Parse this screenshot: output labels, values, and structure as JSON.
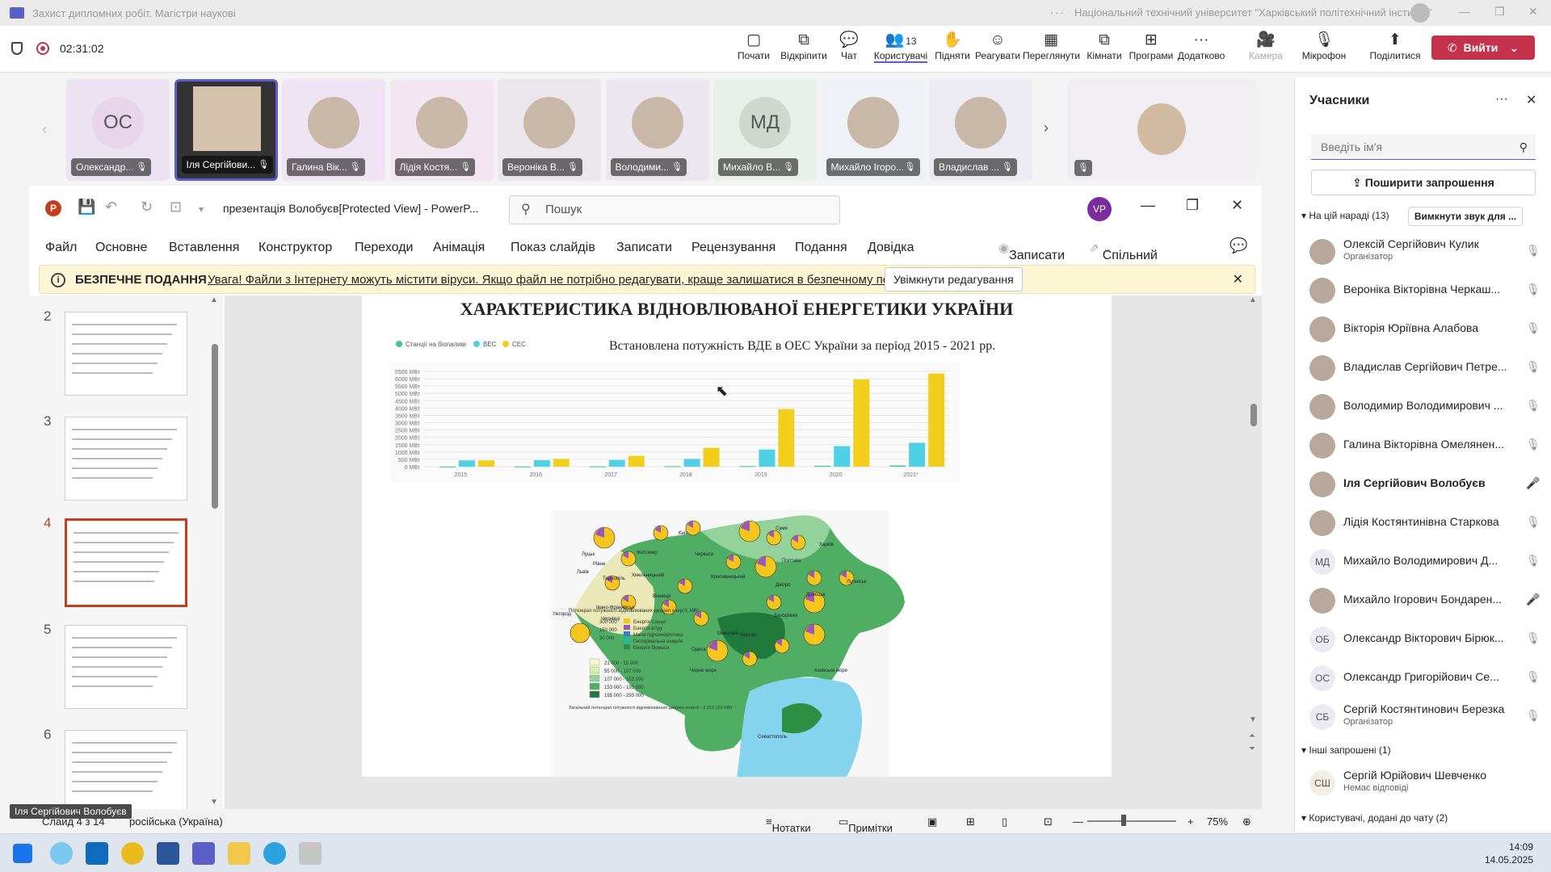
{
  "window": {
    "title": "Захист дипломних робіт. Магістри наукові",
    "org": "Національний технічний університет \"Харківський політехнічний інститут\"",
    "dots": "···"
  },
  "meeting": {
    "timer": "02:31:02",
    "toolbar": [
      {
        "id": "start",
        "label": "Почати",
        "icon": "▢"
      },
      {
        "id": "unpin",
        "label": "Відкріпити",
        "icon": "⧉"
      },
      {
        "id": "chat",
        "label": "Чат",
        "icon": "💬"
      },
      {
        "id": "people",
        "label": "Користувачі",
        "icon": "👥",
        "count": "13",
        "active": true
      },
      {
        "id": "raise",
        "label": "Підняти",
        "icon": "✋"
      },
      {
        "id": "react",
        "label": "Реагувати",
        "icon": "☺"
      },
      {
        "id": "view",
        "label": "Переглянути",
        "icon": "▦"
      },
      {
        "id": "rooms",
        "label": "Кімнати",
        "icon": "⧉"
      },
      {
        "id": "apps",
        "label": "Програми",
        "icon": "⊞"
      },
      {
        "id": "more",
        "label": "Додатково",
        "icon": "···"
      },
      {
        "id": "camera",
        "label": "Камера",
        "icon": "🎥",
        "disabled": true
      },
      {
        "id": "mic",
        "label": "Мікрофон",
        "icon": "🎙"
      },
      {
        "id": "share",
        "label": "Поділитися",
        "icon": "⬆"
      }
    ],
    "leave_label": "Вийти"
  },
  "participants_strip": [
    {
      "name": "Олександр...",
      "initials": "ОС"
    },
    {
      "name": "Іля Сергійови...",
      "photo": true,
      "selected": true
    },
    {
      "name": "Галина Вік...",
      "photo": true
    },
    {
      "name": "Лідія Костя...",
      "photo": true
    },
    {
      "name": "Вероніка В...",
      "photo": true
    },
    {
      "name": "Володими...",
      "photo": true
    },
    {
      "name": "Михайло В...",
      "initials": "МД"
    },
    {
      "name": "Михайло Ігоро...",
      "photo": true
    },
    {
      "name": "Владислав ...",
      "photo": true
    }
  ],
  "ppt": {
    "doc_title": "презентація Волобуєв[Protected View] - PowerP...",
    "search_placeholder": "Пошук",
    "user_initials": "VP",
    "menu": [
      "Файл",
      "Основне",
      "Вставлення",
      "Конструктор",
      "Переходи",
      "Анімація",
      "Показ слайдів",
      "Записати",
      "Рецензування",
      "Подання",
      "Довідка"
    ],
    "record_btn": "Записати",
    "shared_btn": "Спільний доступ",
    "protected_title": "БЕЗПЕЧНЕ ПОДАННЯ",
    "protected_msg": "Увага! Файли з Інтернету можуть містити віруси. Якщо файл не потрібно редагувати, краще залишатися в безпечному поданні.",
    "enable_edit": "Увімкнути редагування",
    "slide_numbers": [
      "2",
      "3",
      "4",
      "5",
      "6"
    ],
    "current_slide": "4",
    "slide_title": "ХАРАКТЕРИСТИКА ВІДНОВЛЮВАНОЇ ЕНЕРГЕТИКИ УКРАЇНИ",
    "chart_caption": "Встановлена потужність ВДЕ в ОЕС України за період 2015 - 2021 рр.",
    "status_slide": "Слайд 4 з 14",
    "status_lang": "російська (Україна)",
    "status_notes": "Нотатки",
    "status_comments": "Примітки",
    "zoom": "75%",
    "tooltip": "Іля Сергійович Волобуєв"
  },
  "chart_data": {
    "type": "bar",
    "title": "",
    "categories": [
      "2015",
      "2016",
      "2017",
      "2018",
      "2019",
      "2020",
      "2021*"
    ],
    "series": [
      {
        "name": "Станції на біопаливі",
        "color": "#3cc98a",
        "values": [
          10,
          15,
          20,
          30,
          40,
          60,
          80
        ]
      },
      {
        "name": "ВЕС",
        "color": "#4fd0e4",
        "values": [
          430,
          440,
          460,
          530,
          1170,
          1400,
          1630
        ]
      },
      {
        "name": "СЕС",
        "color": "#f2cf1d",
        "values": [
          430,
          530,
          740,
          1290,
          3930,
          5960,
          6350
        ]
      }
    ],
    "yticks": [
      "0 МВт",
      "500 МВт",
      "1000 МВт",
      "1500 МВт",
      "2000 МВт",
      "2500 МВт",
      "3000 МВт",
      "3500 МВт",
      "4000 МВт",
      "4500 МВт",
      "5000 МВт",
      "5500 МВт",
      "6000 МВт",
      "6500 МВт"
    ],
    "ylim": [
      0,
      6500
    ],
    "grid": true,
    "legend": "top-left"
  },
  "map": {
    "legend_title": "Потенціал потужності відновлюваних джерел енергії, МВт",
    "pie_sizes": [
      "300 000",
      "150 000",
      "30 000"
    ],
    "pie_legend": [
      "Енергія Сонця",
      "Енергія вітру",
      "Мала гідроенергетика",
      "Геотермальна енергія",
      "Енергія біомаси"
    ],
    "ranges": [
      "21 000 - 55 000",
      "55 000 - 107 000",
      "107 000 - 153 000",
      "153 000 - 195 000",
      "195 000 - 293 000"
    ],
    "total": "Загальний потенціал потужності відновлюваних джерел енергії - 3 313 163 МВт",
    "labels": [
      "Київ",
      "Черкаси",
      "Кропивницький",
      "Суми",
      "Харків",
      "Полтава",
      "Дніпро",
      "Запоріжжя",
      "Херсон",
      "Миколаїв",
      "Одеса",
      "Чорне море",
      "Азовське море",
      "Севастополь",
      "Донецьк",
      "Луганськ",
      "Луцьк",
      "Рівне",
      "Житомир",
      "Львів",
      "Тернопіль",
      "Хмельницький",
      "Вінниця",
      "Ужгород",
      "Івано-Франківськ",
      "Чернівці"
    ]
  },
  "people_panel": {
    "title": "Учасники",
    "search_placeholder": "Введіть ім'я",
    "invite": "Поширити запрошення",
    "in_meeting": "На цій нараді (13)",
    "mute_all": "Вимкнути звук для ...",
    "list": [
      {
        "name": "Олексій Сергійович Кулик",
        "role": "Організатор",
        "mic": "off"
      },
      {
        "name": "Вероніка Вікторівна Черкаш...",
        "mic": "off"
      },
      {
        "name": "Вікторія Юріївна Алабова",
        "mic": "off"
      },
      {
        "name": "Владислав Сергійович Петре...",
        "mic": "off"
      },
      {
        "name": "Володимир Володимирович ...",
        "mic": "off"
      },
      {
        "name": "Галина Вікторівна Омелянен...",
        "mic": "off"
      },
      {
        "name": "Іля Сергійович Волобуєв",
        "mic": "on",
        "bold": true
      },
      {
        "name": "Лідія Костянтинівна Старкова",
        "mic": "off"
      },
      {
        "name": "Михайло Володимирович Д...",
        "mic": "off",
        "initials": "МД"
      },
      {
        "name": "Михайло Ігорович Бондарен...",
        "mic": "on"
      },
      {
        "name": "Олександр Вікторович Бірюк...",
        "mic": "off",
        "initials": "ОБ"
      },
      {
        "name": "Олександр Григорійович Се...",
        "mic": "off",
        "initials": "ОС"
      },
      {
        "name": "Сергій Костянтинович Березка",
        "role": "Організатор",
        "mic": "off",
        "initials": "СБ"
      }
    ],
    "others": "Інші запрошені (1)",
    "other_person": {
      "name": "Сергій Юрійович Шевченко",
      "role": "Немає відповіді",
      "initials": "СШ"
    },
    "chat_added": "Користувачі, додані до чату (2)"
  },
  "taskbar": {
    "time": "14:09",
    "date": "14.05.2025"
  }
}
